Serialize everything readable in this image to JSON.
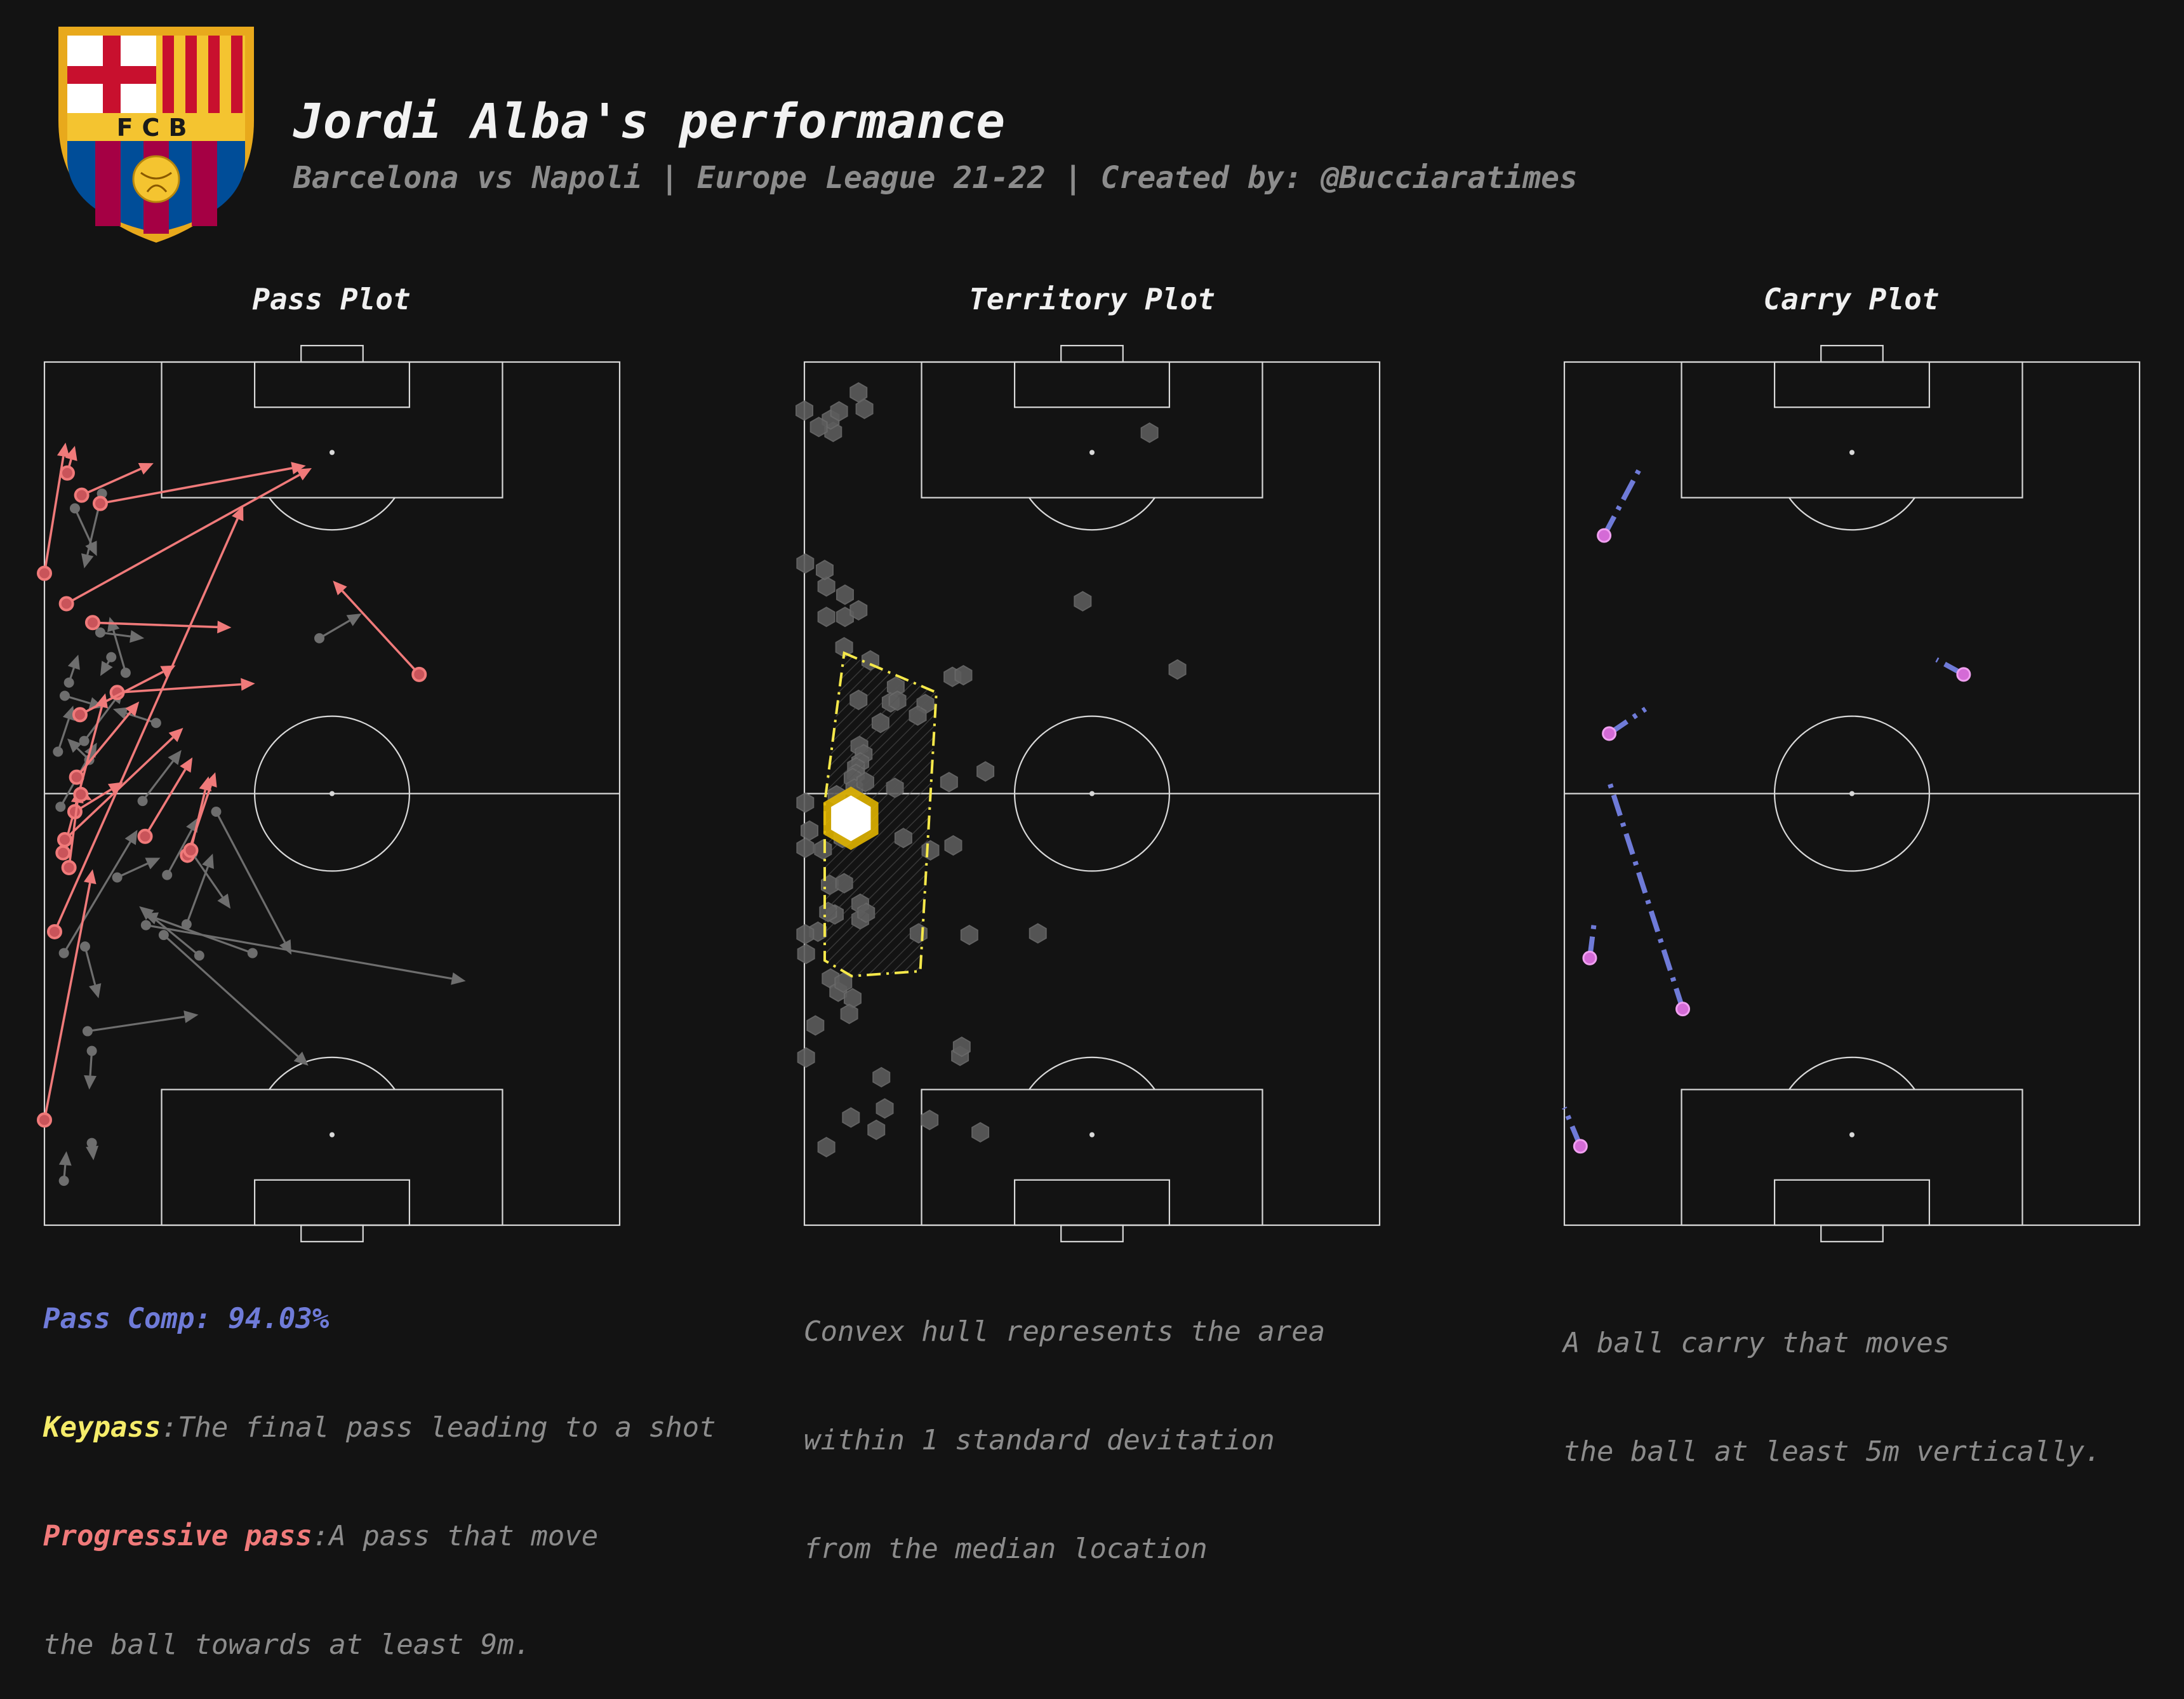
{
  "header": {
    "title": "Jordi Alba's performance",
    "subtitle": "Barcelona vs Napoli | Europe League 21-22 | Created by: @Bucciaratimes",
    "crest_text": "FCB"
  },
  "colors": {
    "background": "#131313",
    "pitch_lines": "#d9d9d9",
    "pass_normal": "#6e6e6e",
    "pass_progressive": "#f07a7a",
    "keypass": "#f5ec6a",
    "carry": "#6f7bd8",
    "carry_start": "#d46bd6",
    "hull": "#f5e84a",
    "hex": "#5c5c5c"
  },
  "panels": {
    "pass": {
      "title": "Pass Plot",
      "completion_label": "Pass Comp: 94.03%",
      "keypass_label": "Keypass",
      "keypass_desc": ":The final pass leading to a shot",
      "progressive_label": "Progressive pass",
      "progressive_desc": ":A pass that move",
      "progressive_desc2": "the ball towards at least 9m."
    },
    "territory": {
      "title": "Territory Plot",
      "note_lines": [
        "Convex hull represents the area",
        "within 1 standard devitation",
        "from the median location"
      ]
    },
    "carry": {
      "title": "Carry Plot",
      "note_lines": [
        "A ball carry that moves",
        "the ball at least 5m vertically."
      ]
    }
  },
  "chart_data": [
    {
      "type": "scatter",
      "title": "Pass Plot",
      "pitch": {
        "length": 105,
        "width": 68,
        "orientation": "vertical",
        "attack": "up"
      },
      "series": [
        {
          "name": "Progressive pass",
          "passes": [
            {
              "start": [
                0.0,
                79.3
              ],
              "end": [
                2.5,
                95.2
              ]
            },
            {
              "start": [
                4.4,
                88.8
              ],
              "end": [
                12.9,
                92.7
              ]
            },
            {
              "start": [
                6.6,
                87.8
              ],
              "end": [
                30.9,
                92.4
              ]
            },
            {
              "start": [
                2.7,
                91.5
              ],
              "end": [
                3.6,
                94.8
              ]
            },
            {
              "start": [
                2.6,
                75.6
              ],
              "end": [
                31.6,
                92.1
              ]
            },
            {
              "start": [
                5.7,
                73.3
              ],
              "end": [
                22.1,
                72.7
              ]
            },
            {
              "start": [
                1.2,
                35.7
              ],
              "end": [
                23.5,
                87.5
              ]
            },
            {
              "start": [
                8.6,
                64.8
              ],
              "end": [
                24.9,
                65.9
              ]
            },
            {
              "start": [
                4.2,
                62.1
              ],
              "end": [
                15.5,
                68.1
              ]
            },
            {
              "start": [
                2.2,
                45.3
              ],
              "end": [
                7.2,
                64.7
              ]
            },
            {
              "start": [
                3.8,
                54.5
              ],
              "end": [
                11.2,
                63.7
              ]
            },
            {
              "start": [
                2.4,
                46.9
              ],
              "end": [
                16.4,
                60.5
              ]
            },
            {
              "start": [
                11.9,
                47.3
              ],
              "end": [
                17.5,
                56.9
              ]
            },
            {
              "start": [
                16.9,
                45.0
              ],
              "end": [
                20.2,
                55.1
              ]
            },
            {
              "start": [
                17.3,
                45.6
              ],
              "end": [
                19.4,
                54.6
              ]
            },
            {
              "start": [
                3.6,
                50.3
              ],
              "end": [
                9.3,
                53.9
              ]
            },
            {
              "start": [
                2.9,
                43.5
              ],
              "end": [
                4.1,
                53.1
              ]
            },
            {
              "start": [
                4.3,
                52.4
              ],
              "end": [
                5.6,
                51.7
              ]
            },
            {
              "start": [
                0.0,
                12.8
              ],
              "end": [
                5.7,
                43.3
              ]
            },
            {
              "start": [
                44.3,
                67.0
              ],
              "end": [
                34.1,
                78.4
              ]
            }
          ]
        },
        {
          "name": "Pass",
          "passes": [
            {
              "start": [
                6.8,
                89.0
              ],
              "end": [
                4.7,
                79.9
              ]
            },
            {
              "start": [
                3.6,
                87.2
              ],
              "end": [
                6.2,
                81.4
              ]
            },
            {
              "start": [
                32.5,
                71.4
              ],
              "end": [
                37.5,
                74.4
              ]
            },
            {
              "start": [
                6.6,
                72.1
              ],
              "end": [
                11.8,
                71.4
              ]
            },
            {
              "start": [
                9.6,
                67.2
              ],
              "end": [
                7.7,
                74.0
              ]
            },
            {
              "start": [
                4.7,
                58.9
              ],
              "end": [
                9.3,
                65.2
              ]
            },
            {
              "start": [
                13.2,
                61.1
              ],
              "end": [
                8.1,
                62.8
              ]
            },
            {
              "start": [
                20.3,
                50.3
              ],
              "end": [
                29.2,
                32.9
              ]
            },
            {
              "start": [
                14.5,
                42.6
              ],
              "end": [
                18.2,
                49.6
              ]
            },
            {
              "start": [
                12.0,
                36.5
              ],
              "end": [
                49.8,
                29.7
              ]
            },
            {
              "start": [
                18.3,
                32.8
              ],
              "end": [
                11.2,
                38.8
              ]
            },
            {
              "start": [
                14.1,
                35.3
              ],
              "end": [
                31.2,
                19.4
              ]
            },
            {
              "start": [
                5.1,
                23.6
              ],
              "end": [
                18.2,
                25.6
              ]
            },
            {
              "start": [
                2.3,
                33.1
              ],
              "end": [
                11.0,
                48.1
              ]
            },
            {
              "start": [
                4.8,
                33.9
              ],
              "end": [
                6.4,
                27.6
              ]
            },
            {
              "start": [
                5.6,
                21.2
              ],
              "end": [
                5.3,
                16.5
              ]
            },
            {
              "start": [
                5.6,
                10.0
              ],
              "end": [
                5.8,
                7.9
              ]
            },
            {
              "start": [
                2.3,
                5.4
              ],
              "end": [
                2.6,
                9.0
              ]
            },
            {
              "start": [
                24.6,
                33.1
              ],
              "end": [
                11.7,
                37.9
              ]
            },
            {
              "start": [
                16.8,
                36.6
              ],
              "end": [
                19.9,
                45.2
              ]
            },
            {
              "start": [
                8.6,
                42.3
              ],
              "end": [
                13.7,
                44.7
              ]
            },
            {
              "start": [
                17.5,
                45.2
              ],
              "end": [
                22.0,
                38.5
              ]
            },
            {
              "start": [
                11.6,
                51.6
              ],
              "end": [
                16.2,
                57.8
              ]
            },
            {
              "start": [
                1.9,
                50.9
              ],
              "end": [
                6.2,
                58.7
              ]
            },
            {
              "start": [
                1.6,
                57.6
              ],
              "end": [
                3.4,
                63.2
              ]
            },
            {
              "start": [
                5.3,
                56.6
              ],
              "end": [
                2.7,
                59.2
              ]
            },
            {
              "start": [
                2.9,
                66.0
              ],
              "end": [
                4.0,
                69.4
              ]
            },
            {
              "start": [
                7.9,
                69.1
              ],
              "end": [
                6.6,
                66.8
              ]
            },
            {
              "start": [
                2.4,
                64.4
              ],
              "end": [
                7.0,
                63.0
              ]
            }
          ]
        }
      ]
    },
    {
      "type": "heatmap",
      "title": "Territory Plot",
      "pitch": {
        "length": 105,
        "width": 68,
        "orientation": "vertical",
        "attack": "up"
      },
      "hexbin_points": [
        [
          0.0,
          99.1
        ],
        [
          3.4,
          96.5
        ],
        [
          3.1,
          98.0
        ],
        [
          1.7,
          97.1
        ],
        [
          4.1,
          99.0
        ],
        [
          6.4,
          101.3
        ],
        [
          7.1,
          99.3
        ],
        [
          40.8,
          96.4
        ],
        [
          0.1,
          80.5
        ],
        [
          2.6,
          77.7
        ],
        [
          4.8,
          76.7
        ],
        [
          4.8,
          74.0
        ],
        [
          6.4,
          74.8
        ],
        [
          4.7,
          70.3
        ],
        [
          7.8,
          68.7
        ],
        [
          2.6,
          74.0
        ],
        [
          2.4,
          79.7
        ],
        [
          32.9,
          75.9
        ],
        [
          44.1,
          67.6
        ],
        [
          17.5,
          66.7
        ],
        [
          18.8,
          66.9
        ],
        [
          6.4,
          63.9
        ],
        [
          10.2,
          63.6
        ],
        [
          10.8,
          65.5
        ],
        [
          11.0,
          63.8
        ],
        [
          14.3,
          63.4
        ],
        [
          13.4,
          62.0
        ],
        [
          9.0,
          61.1
        ],
        [
          6.5,
          58.3
        ],
        [
          7.0,
          57.3
        ],
        [
          6.6,
          56.3
        ],
        [
          6.1,
          55.7
        ],
        [
          6.1,
          54.9
        ],
        [
          5.7,
          54.4
        ],
        [
          5.9,
          53.1
        ],
        [
          3.8,
          52.3
        ],
        [
          7.2,
          53.9
        ],
        [
          10.7,
          53.2
        ],
        [
          17.1,
          53.9
        ],
        [
          21.4,
          55.2
        ],
        [
          0.1,
          51.4
        ],
        [
          0.6,
          48.0
        ],
        [
          5.7,
          49.4
        ],
        [
          4.5,
          47.1
        ],
        [
          11.7,
          47.1
        ],
        [
          14.9,
          45.6
        ],
        [
          17.6,
          46.2
        ],
        [
          0.1,
          45.9
        ],
        [
          2.2,
          45.7
        ],
        [
          3.0,
          41.4
        ],
        [
          4.7,
          41.6
        ],
        [
          6.6,
          39.1
        ],
        [
          6.6,
          37.2
        ],
        [
          7.3,
          38.0
        ],
        [
          1.6,
          35.7
        ],
        [
          3.6,
          37.8
        ],
        [
          2.8,
          38.1
        ],
        [
          13.5,
          35.5
        ],
        [
          19.5,
          35.3
        ],
        [
          27.6,
          35.5
        ],
        [
          0.1,
          35.4
        ],
        [
          0.2,
          33.0
        ],
        [
          3.1,
          30.0
        ],
        [
          4.0,
          28.4
        ],
        [
          4.6,
          29.5
        ],
        [
          5.7,
          27.6
        ],
        [
          5.3,
          25.7
        ],
        [
          1.3,
          24.3
        ],
        [
          0.2,
          20.4
        ],
        [
          9.1,
          18.0
        ],
        [
          18.4,
          20.6
        ],
        [
          18.6,
          21.7
        ],
        [
          9.5,
          14.2
        ],
        [
          5.5,
          13.1
        ],
        [
          8.5,
          11.6
        ],
        [
          14.8,
          12.8
        ],
        [
          20.8,
          11.3
        ],
        [
          2.6,
          9.5
        ]
      ],
      "peak": [
        5.5,
        49.5
      ],
      "hull_polygon": [
        [
          4.7,
          69.6
        ],
        [
          15.6,
          64.8
        ],
        [
          13.7,
          30.9
        ],
        [
          5.6,
          30.3
        ],
        [
          2.4,
          32.2
        ],
        [
          2.4,
          51.4
        ]
      ]
    },
    {
      "type": "line",
      "title": "Carry Plot",
      "pitch": {
        "length": 105,
        "width": 68,
        "orientation": "vertical",
        "attack": "up"
      },
      "series": [
        {
          "name": "",
          "carries": [
            {
              "start": [
                4.7,
                83.9
              ],
              "end": [
                9.1,
                92.4
              ]
            },
            {
              "start": [
                47.2,
                67.0
              ],
              "end": [
                44.0,
                68.8
              ]
            },
            {
              "start": [
                5.3,
                59.8
              ],
              "end": [
                9.6,
                62.8
              ]
            },
            {
              "start": [
                14.0,
                26.3
              ],
              "end": [
                5.2,
                54.3
              ]
            },
            {
              "start": [
                3.0,
                32.5
              ],
              "end": [
                3.5,
                36.6
              ]
            },
            {
              "start": [
                1.9,
                9.6
              ],
              "end": [
                0.0,
                14.3
              ]
            }
          ]
        }
      ]
    }
  ]
}
